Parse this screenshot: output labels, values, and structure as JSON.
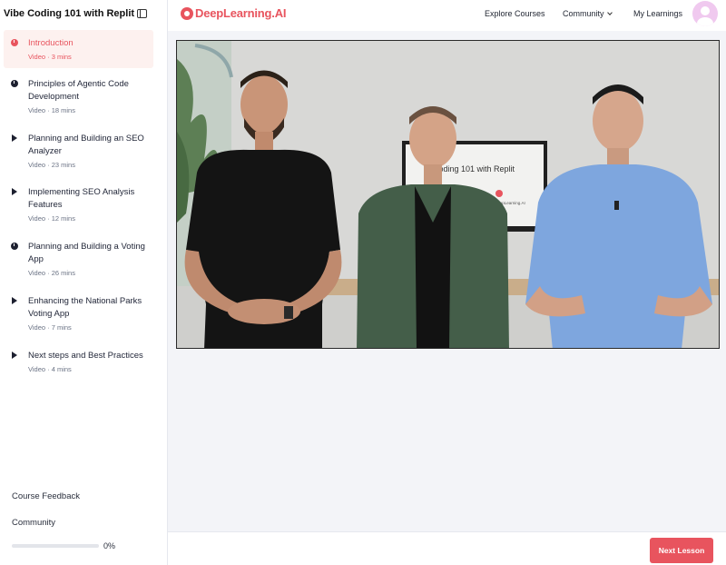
{
  "sidebar": {
    "course_title": "Vibe Coding 101 with Replit",
    "lessons": [
      {
        "title": "Introduction",
        "meta": "Video · 3 mins",
        "icon": "clock-icon",
        "active": true
      },
      {
        "title": "Principles of Agentic Code Development",
        "meta": "Video · 18 mins",
        "icon": "clock-icon"
      },
      {
        "title": "Planning and Building an SEO Analyzer",
        "meta": "Video · 23 mins",
        "icon": "play-icon"
      },
      {
        "title": "Implementing SEO Analysis Features",
        "meta": "Video · 12 mins",
        "icon": "play-icon"
      },
      {
        "title": "Planning and Building a Voting App",
        "meta": "Video · 26 mins",
        "icon": "clock-icon"
      },
      {
        "title": "Enhancing the National Parks Voting App",
        "meta": "Video · 7 mins",
        "icon": "play-icon"
      },
      {
        "title": "Next steps and Best Practices",
        "meta": "Video · 4 mins",
        "icon": "play-icon"
      }
    ],
    "feedback_label": "Course Feedback",
    "community_label": "Community",
    "progress_value": 0,
    "progress_label": "0%"
  },
  "nav": {
    "logo_text": "DeepLearning.AI",
    "explore": "Explore Courses",
    "community": "Community",
    "my_learnings": "My Learnings"
  },
  "video": {
    "screen_text": "Coding 101 with Replit",
    "screen_logo_text": "DeepLearning.AI"
  },
  "footer": {
    "next_label": "Next Lesson"
  },
  "colors": {
    "accent": "#e8545e",
    "sidebar_active_bg": "#fdf1ef",
    "main_bg": "#f3f4f8"
  }
}
